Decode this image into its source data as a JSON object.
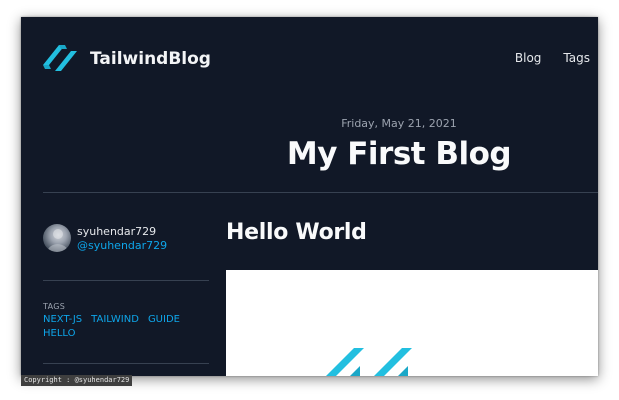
{
  "header": {
    "brand": "TailwindBlog",
    "nav": [
      "Blog",
      "Tags"
    ]
  },
  "post": {
    "date": "Friday, May 21, 2021",
    "title": "My First Blog"
  },
  "author": {
    "name": "syuhendar729",
    "handle": "@syuhendar729"
  },
  "tags": {
    "label": "TAGS",
    "items": [
      "NEXT-JS",
      "TAILWIND",
      "GUIDE",
      "HELLO"
    ]
  },
  "content": {
    "heading": "Hello World"
  },
  "footer": {
    "copyright": "Copyright : @syuhendar729"
  },
  "colors": {
    "background": "#111827",
    "accent": "#0ea5e9",
    "logo": "#22bfe0"
  },
  "icons": {
    "logo": "tailwind-logo-icon"
  }
}
